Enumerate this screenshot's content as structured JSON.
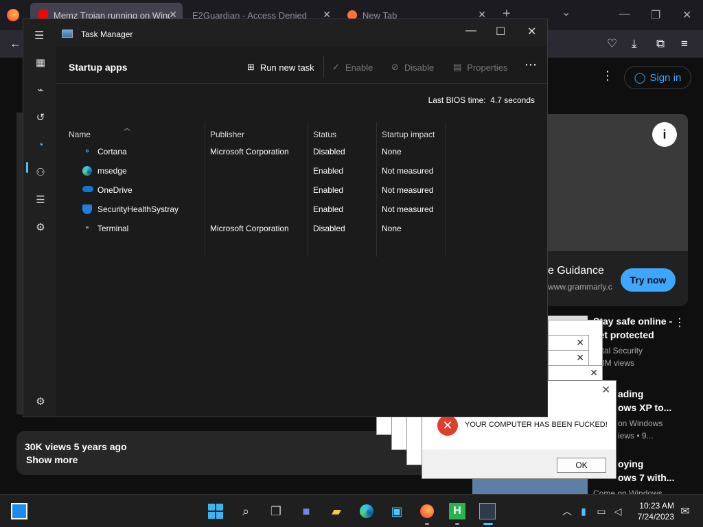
{
  "browser": {
    "tabs": [
      {
        "label": "Memz Trojan running on Wind"
      },
      {
        "label": "E2Guardian - Access Denied"
      },
      {
        "label": "New Tab"
      }
    ],
    "new_tab": "+",
    "tab_list": "⌄"
  },
  "youtube": {
    "sign_in": "Sign in",
    "views": "30K views  5 years ago",
    "show_more": "Show more",
    "ad": {
      "title": "e Guidance",
      "url": "www.grammarly.co",
      "cta": "Try now"
    },
    "recommendations": [
      {
        "title": "Stay safe online - get protected",
        "channel": "Total Security",
        "meta": "4.3M views"
      },
      {
        "title": "ading\nows XP to...",
        "channel": "on Windows",
        "meta": "iews • 9..."
      },
      {
        "title": "oying\nows 7 with...",
        "channel": "Come on Windows",
        "meta": ""
      }
    ]
  },
  "error_dialog": {
    "message": "YOUR COMPUTER HAS BEEN FUCKED!",
    "ok": "OK"
  },
  "task_manager": {
    "title": "Task Manager",
    "page_title": "Startup apps",
    "toolbar": {
      "run_new_task": "Run new task",
      "enable": "Enable",
      "disable": "Disable",
      "properties": "Properties"
    },
    "bios_label": "Last BIOS time:",
    "bios_value": "4.7 seconds",
    "columns": {
      "name": "Name",
      "publisher": "Publisher",
      "status": "Status",
      "impact": "Startup impact"
    },
    "rows": [
      {
        "name": "Cortana",
        "publisher": "Microsoft Corporation",
        "status": "Disabled",
        "impact": "None",
        "icon": "cortana-icon"
      },
      {
        "name": "msedge",
        "publisher": "",
        "status": "Enabled",
        "impact": "Not measured",
        "icon": "edge-icon"
      },
      {
        "name": "OneDrive",
        "publisher": "",
        "status": "Enabled",
        "impact": "Not measured",
        "icon": "onedrive-icon"
      },
      {
        "name": "SecurityHealthSystray",
        "publisher": "",
        "status": "Enabled",
        "impact": "Not measured",
        "icon": "shield-icon"
      },
      {
        "name": "Terminal",
        "publisher": "Microsoft Corporation",
        "status": "Disabled",
        "impact": "None",
        "icon": "terminal-icon"
      }
    ]
  },
  "taskbar": {
    "time": "10:23 AM",
    "date": "7/24/2023"
  }
}
